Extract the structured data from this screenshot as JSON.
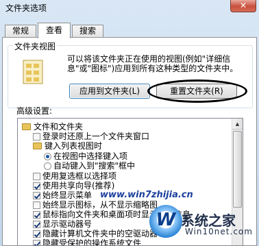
{
  "window": {
    "title": "文件夹选项",
    "close_label": "✕"
  },
  "tabs": [
    {
      "label": "常规",
      "active": false
    },
    {
      "label": "查看",
      "active": true
    },
    {
      "label": "搜索",
      "active": false
    }
  ],
  "folder_views": {
    "legend": "文件夹视图",
    "description": "可以将该文件夹正在使用的视图(例如\"详细信息\"或\"图标\")应用到所有这种类型的文件夹中。",
    "apply_button": "应用到文件夹(L)",
    "reset_button": "重置文件夹(R)"
  },
  "advanced": {
    "label": "高级设置:",
    "items": [
      {
        "text": "文件和文件夹",
        "kind": "folder"
      },
      {
        "text": "登录时还原上一个文件夹窗口",
        "kind": "checkbox",
        "checked": false
      },
      {
        "text": "键入列表视图时",
        "kind": "folder"
      },
      {
        "text": "在视图中选择键入项",
        "kind": "radio",
        "checked": true
      },
      {
        "text": "自动键入到\"搜索\"框中",
        "kind": "radio",
        "checked": false
      },
      {
        "text": "使用复选框以选择项",
        "kind": "checkbox",
        "checked": false
      },
      {
        "text": "使用共享向导(推荐)",
        "kind": "checkbox",
        "checked": true
      },
      {
        "text": "始终显示菜单",
        "kind": "checkbox",
        "checked": true
      },
      {
        "text": "始终显示图标，从不显示缩略图",
        "kind": "checkbox",
        "checked": false
      },
      {
        "text": "鼠标指向文件夹和桌面项时显示提示信息",
        "kind": "checkbox",
        "checked": true
      },
      {
        "text": "显示驱动器号",
        "kind": "checkbox",
        "checked": true
      },
      {
        "text": "隐藏计算机文件夹中的空驱动器",
        "kind": "checkbox",
        "checked": true
      },
      {
        "text": "隐藏受保护的操作系统文件",
        "kind": "checkbox",
        "checked": true
      }
    ]
  },
  "watermark": {
    "url": "www.win7zhijia.cn",
    "logo_main": "系统之家",
    "logo_sub": "Win10net.com"
  }
}
